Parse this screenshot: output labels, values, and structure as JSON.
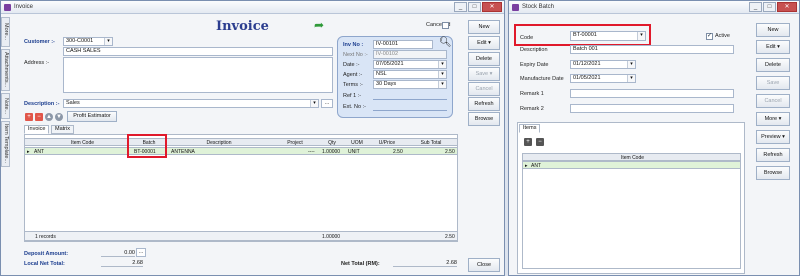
{
  "invoice": {
    "title_bar": "Invoice",
    "window_buttons": {
      "min": "_",
      "max": "□",
      "close": "✕"
    },
    "heading": "Invoice",
    "cancelled_label": "Cancelled",
    "side_tabs": [
      "More...",
      "Attachments...",
      "Note...",
      "Item Template..."
    ],
    "customer_label": "Customer :-",
    "customer_code": "300-C0001",
    "customer_name": "CASH SALES",
    "address_label": "Address :-",
    "description_label": "Description :-",
    "description_value": "Sales",
    "ellipsis": "...",
    "profit_estimator": "Profit Estimator",
    "tabs": [
      "Invoice",
      "Matrix"
    ],
    "inv_no_label": "Inv No :",
    "inv_no_value": "IV-00101",
    "next_no_label": "Next No :-",
    "next_no_value": "IV-00102",
    "date_label": "Date :-",
    "date_value": "07/05/2021",
    "agent_label": "Agent :-",
    "agent_value": "NSL",
    "terms_label": "Terms :-",
    "terms_value": "30 Days",
    "ref1_label": "Ref 1 :-",
    "ext_no_label": "Ext. No :-",
    "columns": [
      "Item Code",
      "Batch",
      "Description",
      "Project",
      "Qty",
      "UOM",
      "U/Price",
      "Sub Total"
    ],
    "row": {
      "item_code": "ANT",
      "batch": "BT-00001",
      "description": "ANTENNA",
      "project": "----",
      "qty": "1.00000",
      "uom": "UNIT",
      "price": "2.50",
      "subtotal": "2.50"
    },
    "footer_records": "1 records",
    "footer_qty": "1.00000",
    "footer_subtotal": "2.50",
    "deposit_label": "Deposit Amount:",
    "deposit_value": "0.00",
    "local_net_label": "Local Net Total:",
    "local_net_value": "2.68",
    "net_total_label": "Net Total (RM):",
    "net_total_value": "2.68",
    "buttons": {
      "new": "New",
      "edit": "Edit",
      "delete": "Delete",
      "save": "Save",
      "cancel": "Cancel",
      "refresh": "Refresh",
      "browse": "Browse",
      "close": "Close"
    }
  },
  "batch": {
    "title_bar": "Stock Batch",
    "window_buttons": {
      "min": "_",
      "max": "□",
      "close": "✕"
    },
    "code_label": "Code",
    "code_value": "BT-00001",
    "active_label": "Active",
    "description_label": "Description",
    "description_value": "Batch 001",
    "expiry_label": "Expiry Date",
    "expiry_value": "01/12/2021",
    "manufacture_label": "Manufacture Date",
    "manufacture_value": "01/05/2021",
    "remark1_label": "Remark 1",
    "remark2_label": "Remark 2",
    "items_tab": "Items",
    "item_code_col": "Item Code",
    "item_row": "ANT",
    "buttons": {
      "new": "New",
      "edit": "Edit",
      "delete": "Delete",
      "save": "Save",
      "cancel": "Cancel",
      "more": "More",
      "preview": "Preview",
      "refresh": "Refresh",
      "browse": "Browse"
    }
  },
  "colors": {
    "highlight": "#e0192b",
    "heading": "#2b3d8f",
    "selected_row": "#dff2d8"
  }
}
